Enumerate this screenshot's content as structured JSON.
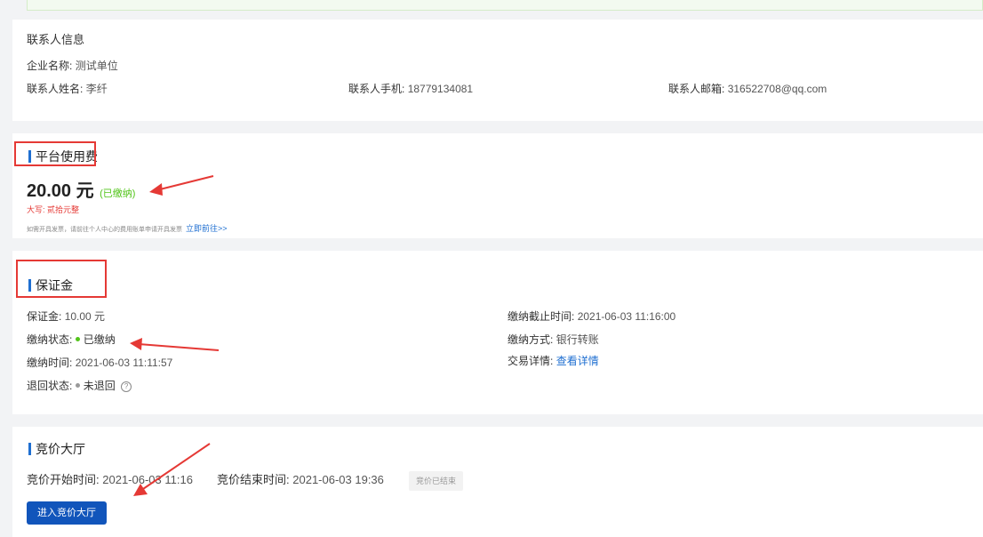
{
  "contact": {
    "section_title": "联系人信息",
    "company_label": "企业名称:",
    "company_value": "测试单位",
    "name_label": "联系人姓名:",
    "name_value": "李纤",
    "phone_label": "联系人手机:",
    "phone_value": "18779134081",
    "email_label": "联系人邮箱:",
    "email_value": "316522708@qq.com"
  },
  "platform_fee": {
    "section_title": "平台使用费",
    "amount": "20.00 元",
    "status": "(已缴纳)",
    "capital_label": "大写:",
    "capital_value": "贰拾元整",
    "invoice_note": "如需开具发票，请前往个人中心的费用账单申请开具发票",
    "invoice_link": "立即前往>>"
  },
  "deposit": {
    "section_title": "保证金",
    "amount_label": "保证金:",
    "amount_value": "10.00 元",
    "pay_status_label": "缴纳状态:",
    "pay_status_value": "已缴纳",
    "pay_time_label": "缴纳时间:",
    "pay_time_value": "2021-06-03 11:11:57",
    "refund_status_label": "退回状态:",
    "refund_status_value": "未退回",
    "deadline_label": "缴纳截止时间:",
    "deadline_value": "2021-06-03 11:16:00",
    "method_label": "缴纳方式:",
    "method_value": "银行转账",
    "trade_label": "交易详情:",
    "trade_link": "查看详情",
    "colors": {
      "paid_dot": "#52c41a",
      "unrefunded_dot": "#999999"
    }
  },
  "auction": {
    "section_title": "竞价大厅",
    "start_label": "竞价开始时间:",
    "start_value": "2021-06-03 11:16",
    "end_label": "竞价结束时间:",
    "end_value": "2021-06-03 19:36",
    "status_badge": "竞价已结束",
    "enter_button": "进入竞价大厅"
  },
  "colors": {
    "accent": "#1f6fd1",
    "annotation_red": "#e53935",
    "paid_green": "#52c41a",
    "capital_red": "#e53935"
  },
  "icons": {
    "help": "question-circle-icon"
  }
}
